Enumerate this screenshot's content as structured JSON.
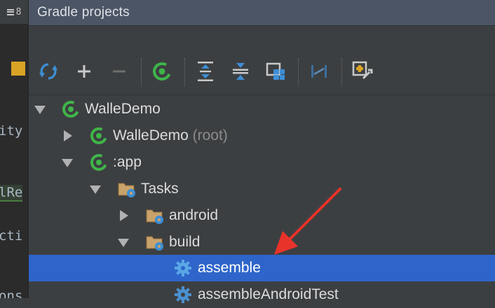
{
  "left_gutter": {
    "tab_number": "8",
    "code_fragments": [
      "ity",
      "lRe",
      "cti",
      "ons"
    ]
  },
  "panel": {
    "title": "Gradle projects"
  },
  "toolbar": {
    "buttons": [
      "refresh-icon",
      "add-icon",
      "remove-icon",
      "gradle-execute-icon",
      "expand-all-icon",
      "collapse-all-icon",
      "attach-project-icon",
      "toggle-offline-icon",
      "settings-icon"
    ]
  },
  "tree": {
    "root": {
      "label": "WalleDemo"
    },
    "root_project": {
      "label": "WalleDemo",
      "suffix": "(root)"
    },
    "app": {
      "label": ":app"
    },
    "tasks": {
      "label": "Tasks"
    },
    "android": {
      "label": "android"
    },
    "build": {
      "label": "build"
    },
    "assemble": {
      "label": "assemble"
    },
    "assemble_android_test": {
      "label": "assembleAndroidTest"
    }
  },
  "colors": {
    "selection": "#2f65ca",
    "gradle_green": "#3fb549",
    "annotation_arrow": "#e8332b"
  }
}
